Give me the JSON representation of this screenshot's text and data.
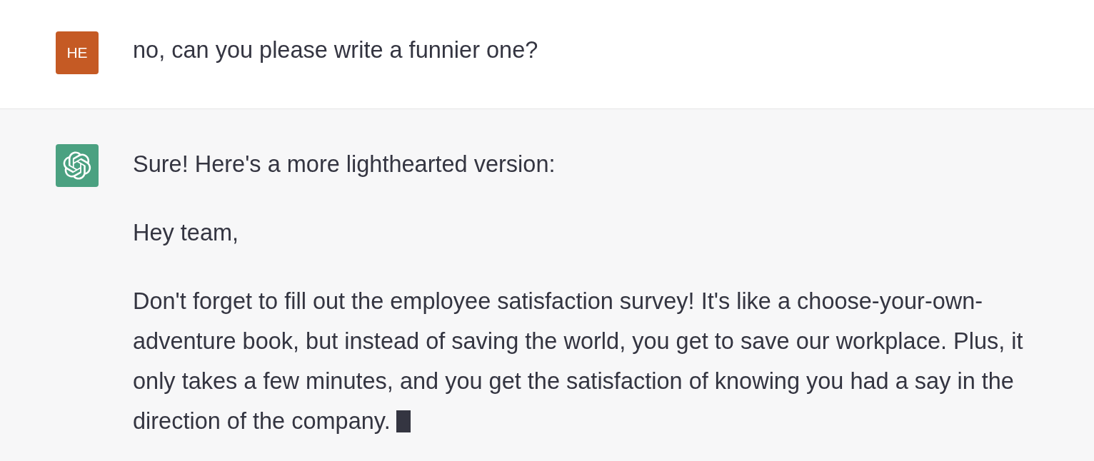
{
  "messages": [
    {
      "kind": "user",
      "avatar": {
        "initials": "HE",
        "color": "#c55a24"
      },
      "paragraphs": [
        "no, can you please write a funnier one?"
      ],
      "streaming": false
    },
    {
      "kind": "assistant",
      "avatar": {
        "color": "#4ba181"
      },
      "paragraphs": [
        "Sure! Here's a more lighthearted version:",
        "Hey team,",
        "Don't forget to fill out the employee satisfaction survey! It's like a choose-your-own-adventure book, but instead of saving the world, you get to save our workplace. Plus, it only takes a few minutes, and you get the satisfaction of knowing you had a say in the direction of the company."
      ],
      "streaming": true
    }
  ]
}
